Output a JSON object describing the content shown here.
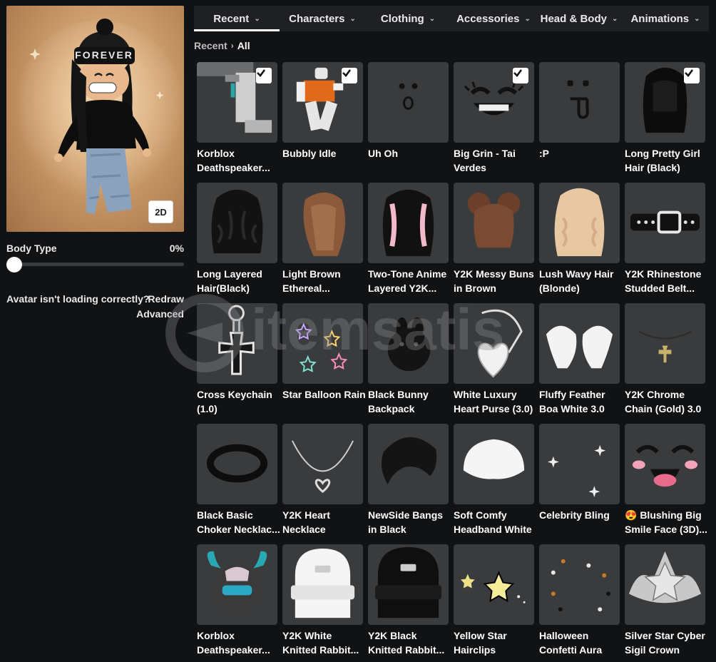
{
  "preview": {
    "hat_text": "FOREVER",
    "toggle_label": "2D"
  },
  "body_type": {
    "label": "Body Type",
    "value": "0%",
    "level": 0
  },
  "notice": {
    "text": "Avatar isn't loading correctly?",
    "redraw_label": "Redraw",
    "advanced_label": "Advanced"
  },
  "tabs": [
    {
      "label": "Recent",
      "active": true
    },
    {
      "label": "Characters",
      "active": false
    },
    {
      "label": "Clothing",
      "active": false
    },
    {
      "label": "Accessories",
      "active": false
    },
    {
      "label": "Head & Body",
      "active": false
    },
    {
      "label": "Animations",
      "active": false
    }
  ],
  "breadcrumb": {
    "parent": "Recent",
    "current": "All"
  },
  "items": [
    {
      "name": "Korblox Deathspeaker...",
      "checked": true,
      "art": "korblox-leg"
    },
    {
      "name": "Bubbly Idle",
      "checked": true,
      "art": "idle-figure"
    },
    {
      "name": "Uh Oh",
      "checked": false,
      "art": "face-uhoh"
    },
    {
      "name": "Big Grin - Tai Verdes",
      "checked": true,
      "art": "face-grin"
    },
    {
      "name": ":P",
      "checked": false,
      "art": "face-tongue"
    },
    {
      "name": "Long Pretty Girl Hair (Black)",
      "checked": true,
      "art": "hair-black-long"
    },
    {
      "name": "Long Layered Hair(Black)",
      "checked": false,
      "art": "hair-black-layered"
    },
    {
      "name": "Light Brown Ethereal...",
      "checked": false,
      "art": "hair-light-brown"
    },
    {
      "name": "Two-Tone Anime Layered Y2K...",
      "checked": false,
      "art": "hair-two-tone"
    },
    {
      "name": "Y2K Messy Buns in Brown",
      "checked": false,
      "art": "hair-buns"
    },
    {
      "name": "Lush Wavy Hair (Blonde)",
      "checked": false,
      "art": "hair-blonde"
    },
    {
      "name": "Y2K Rhinestone Studded Belt...",
      "checked": false,
      "art": "belt"
    },
    {
      "name": "Cross Keychain (1.0)",
      "checked": false,
      "art": "cross"
    },
    {
      "name": "Star Balloon Rain",
      "checked": false,
      "art": "stars"
    },
    {
      "name": "Black Bunny Backpack",
      "checked": false,
      "art": "bunny"
    },
    {
      "name": "White Luxury Heart Purse (3.0)",
      "checked": false,
      "art": "purse"
    },
    {
      "name": "Fluffy Feather Boa White 3.0",
      "checked": false,
      "art": "boa"
    },
    {
      "name": "Y2K Chrome Chain (Gold) 3.0",
      "checked": false,
      "art": "chain"
    },
    {
      "name": "Black Basic Choker Necklac...",
      "checked": false,
      "art": "choker"
    },
    {
      "name": "Y2K Heart Necklace",
      "checked": false,
      "art": "heart-necklace"
    },
    {
      "name": "NewSide Bangs in Black",
      "checked": false,
      "art": "bangs"
    },
    {
      "name": "Soft Comfy Headband White",
      "checked": false,
      "art": "headband"
    },
    {
      "name": "Celebrity Bling",
      "checked": false,
      "art": "sparkles"
    },
    {
      "name": "😍 Blushing Big Smile Face (3D)...",
      "checked": false,
      "art": "face-blush"
    },
    {
      "name": "Korblox Deathspeaker...",
      "checked": false,
      "art": "korblox-helm"
    },
    {
      "name": "Y2K White Knitted Rabbit...",
      "checked": false,
      "art": "beanie-white"
    },
    {
      "name": "Y2K Black Knitted Rabbit...",
      "checked": false,
      "art": "beanie-black"
    },
    {
      "name": "Yellow Star Hairclips",
      "checked": false,
      "art": "star-clips"
    },
    {
      "name": "Halloween Confetti Aura",
      "checked": false,
      "art": "confetti"
    },
    {
      "name": "Silver Star Cyber Sigil Crown",
      "checked": false,
      "art": "crown"
    }
  ],
  "colors": {
    "background": "#111214",
    "tile": "#393b3d",
    "tab_bar": "#1f2023",
    "text": "#ffffff"
  }
}
